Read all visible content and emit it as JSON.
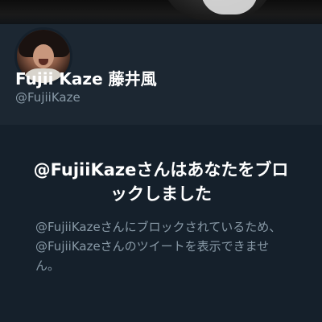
{
  "profile": {
    "display_name": "Fujii Kaze 藤井風",
    "handle": "@FujiiKaze",
    "avatar_icon": "profile-avatar"
  },
  "blocked": {
    "title": "@FujiiKazeさんはあなたをブロックしました",
    "description": "@FujiiKazeさんにブロックされているため、@FujiiKazeさんのツイートを表示できません。"
  },
  "colors": {
    "background": "#15202b",
    "profile_background": "#1c2732",
    "primary_text": "#ffffff",
    "secondary_text": "#8899a6"
  }
}
